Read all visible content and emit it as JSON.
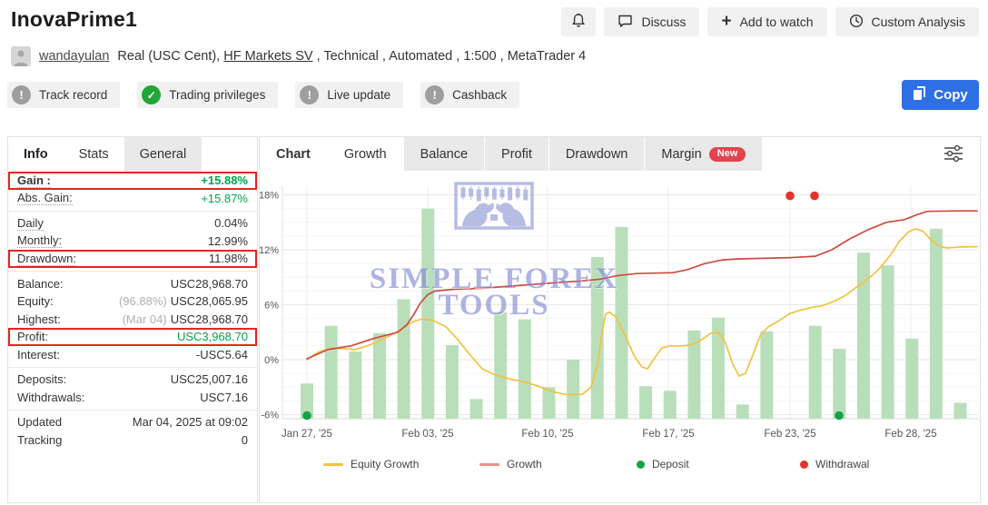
{
  "header": {
    "title": "InovaPrime1",
    "actions": [
      {
        "label": "Discuss",
        "icon": "chat-bubble-icon"
      },
      {
        "label": "Add to watch",
        "icon": "plus-icon"
      },
      {
        "label": "Custom Analysis",
        "icon": "clock-icon"
      }
    ],
    "account": {
      "user": "wandayulan",
      "meta_1": "Real (USC Cent), ",
      "broker": "HF Markets SV",
      "meta_2": " , Technical , Automated , 1:500 , MetaTrader 4"
    },
    "badges": [
      {
        "label": "Track record",
        "status": "warn"
      },
      {
        "label": "Trading privileges",
        "status": "ok"
      },
      {
        "label": "Live update",
        "status": "warn"
      },
      {
        "label": "Cashback",
        "status": "warn"
      }
    ],
    "copy_label": "Copy"
  },
  "colors": {
    "accent_blue": "#2f6fe4",
    "positive_green": "#00a651",
    "highlight_red_box": "#e22621",
    "verified_green": "#21a637",
    "badge_gray": "#9e9e9e",
    "new_badge": "#e0444e",
    "bar_green": "#b9dfba",
    "equity_line_yellow": "#f2c240",
    "growth_line_red": "#cf4a41",
    "deposit_dot_green": "#17a147",
    "withdrawal_dot_red": "#e63228",
    "watermark_blue": "#9aa2dd"
  },
  "sidebar": {
    "tabs": [
      {
        "label": "Info",
        "style": "bold"
      },
      {
        "label": "Stats",
        "style": ""
      },
      {
        "label": "General",
        "style": "filled"
      }
    ],
    "rows": [
      {
        "label": "Gain :",
        "value": "+15.88%",
        "green": true,
        "boxed": true,
        "dotted": true,
        "bold": true
      },
      {
        "label": "Abs. Gain:",
        "value": "+15.87%",
        "green": true,
        "dotted": true
      },
      {
        "divider": true
      },
      {
        "label": "Daily",
        "value": "0.04%",
        "dotted": true
      },
      {
        "label": "Monthly:",
        "value": "12.99%",
        "dotted": true
      },
      {
        "label": "Drawdown:",
        "value": "11.98%",
        "boxed": true,
        "dotted": true
      },
      {
        "divider": true
      },
      {
        "label": "Balance:",
        "value": "USC28,968.70"
      },
      {
        "label": "Equity:",
        "prefix": "(96.88%)",
        "value": "USC28,065.95"
      },
      {
        "label": "Highest:",
        "prefix": "(Mar 04)",
        "value": "USC28,968.70"
      },
      {
        "label": "Profit:",
        "value": "USC3,968.70",
        "green": true,
        "boxed": true
      },
      {
        "label": "Interest:",
        "value": "-USC5.64"
      },
      {
        "divider": true
      },
      {
        "label": "Deposits:",
        "value": "USC25,007.16"
      },
      {
        "label": "Withdrawals:",
        "value": "USC7.16"
      },
      {
        "divider": true
      },
      {
        "label": "Updated",
        "value": "Mar 04, 2025 at 09:02"
      },
      {
        "label": "Tracking",
        "value": "0"
      }
    ]
  },
  "chart_tabs": [
    {
      "label": "Chart",
      "bold": true,
      "white": true
    },
    {
      "label": "Growth",
      "white": true
    },
    {
      "label": "Balance"
    },
    {
      "label": "Profit"
    },
    {
      "label": "Drawdown"
    },
    {
      "label": "Margin",
      "badge": "New"
    }
  ],
  "chart_data": {
    "type": "bar+line",
    "title": "Growth",
    "grid": true,
    "y_axis": {
      "tick_values": [
        18,
        12,
        6,
        0,
        -6
      ],
      "tick_suffix": "%",
      "min": -6.5,
      "max": 18.8
    },
    "x_axis": {
      "labels": [
        "Jan 27, '25",
        "Feb 03, '25",
        "Feb 10, '25",
        "Feb 17, '25",
        "Feb 23, '25",
        "Feb 28, '25"
      ],
      "positions": [
        52,
        185,
        317,
        450,
        584,
        717
      ]
    },
    "bars": {
      "name": "Daily change",
      "color": "#b9dfba",
      "x_start": 52,
      "step": 26.65,
      "width": 14,
      "baseline": -6.45,
      "values": [
        -2.6,
        3.7,
        0.9,
        2.9,
        6.6,
        16.5,
        1.6,
        -4.3,
        5.2,
        4.4,
        -3.0,
        0.0,
        11.2,
        14.5,
        -2.9,
        -3.4,
        3.2,
        4.6,
        -4.9,
        3.1,
        null,
        3.7,
        1.2,
        11.7,
        10.3,
        2.3,
        14.3,
        -4.7
      ]
    },
    "series": [
      {
        "name": "Equity Growth",
        "color": "#f2c240",
        "points": [
          [
            52,
            0
          ],
          [
            65,
            0.85
          ],
          [
            78,
            1.25
          ],
          [
            93,
            1.2
          ],
          [
            105,
            1.1
          ],
          [
            118,
            1.5
          ],
          [
            131,
            2.0
          ],
          [
            145,
            2.7
          ],
          [
            157,
            3.4
          ],
          [
            170,
            4.2
          ],
          [
            180,
            4.45
          ],
          [
            191,
            4.3
          ],
          [
            205,
            3.6
          ],
          [
            218,
            2.2
          ],
          [
            231,
            0.6
          ],
          [
            245,
            -1.0
          ],
          [
            260,
            -1.7
          ],
          [
            275,
            -2.1
          ],
          [
            290,
            -2.4
          ],
          [
            307,
            -2.9
          ],
          [
            323,
            -3.5
          ],
          [
            337,
            -3.8
          ],
          [
            355,
            -3.8
          ],
          [
            365,
            -3.0
          ],
          [
            372,
            -0.5
          ],
          [
            377,
            3.0
          ],
          [
            381,
            5.0
          ],
          [
            385,
            5.2
          ],
          [
            393,
            4.6
          ],
          [
            403,
            2.5
          ],
          [
            413,
            0.3
          ],
          [
            421,
            -0.8
          ],
          [
            427,
            -1.0
          ],
          [
            435,
            0.2
          ],
          [
            443,
            1.3
          ],
          [
            451,
            1.5
          ],
          [
            463,
            1.5
          ],
          [
            475,
            1.6
          ],
          [
            487,
            2.2
          ],
          [
            497,
            2.9
          ],
          [
            505,
            3.0
          ],
          [
            513,
            1.8
          ],
          [
            521,
            -0.5
          ],
          [
            528,
            -1.8
          ],
          [
            535,
            -1.5
          ],
          [
            543,
            0.5
          ],
          [
            551,
            2.6
          ],
          [
            560,
            3.6
          ],
          [
            571,
            4.2
          ],
          [
            583,
            5.0
          ],
          [
            595,
            5.4
          ],
          [
            608,
            5.7
          ],
          [
            620,
            5.9
          ],
          [
            633,
            6.4
          ],
          [
            645,
            7.0
          ],
          [
            658,
            8.0
          ],
          [
            670,
            8.8
          ],
          [
            683,
            10.0
          ],
          [
            695,
            11.5
          ],
          [
            705,
            13.0
          ],
          [
            715,
            14.0
          ],
          [
            723,
            14.3
          ],
          [
            731,
            14.0
          ],
          [
            740,
            13.0
          ],
          [
            748,
            12.4
          ],
          [
            757,
            12.2
          ],
          [
            770,
            12.3
          ],
          [
            790,
            12.35
          ]
        ]
      },
      {
        "name": "Growth",
        "color": "#cf4a41",
        "legend_color": "#e4918a",
        "points": [
          [
            52,
            0.1
          ],
          [
            75,
            1.1
          ],
          [
            100,
            1.5
          ],
          [
            125,
            2.3
          ],
          [
            152,
            3.0
          ],
          [
            162,
            3.8
          ],
          [
            170,
            5.0
          ],
          [
            177,
            6.2
          ],
          [
            185,
            7.1
          ],
          [
            193,
            7.5
          ],
          [
            215,
            7.7
          ],
          [
            245,
            7.8
          ],
          [
            285,
            8.1
          ],
          [
            325,
            8.4
          ],
          [
            355,
            8.6
          ],
          [
            375,
            8.8
          ],
          [
            395,
            9.2
          ],
          [
            415,
            9.4
          ],
          [
            435,
            9.45
          ],
          [
            455,
            9.5
          ],
          [
            470,
            9.8
          ],
          [
            490,
            10.5
          ],
          [
            510,
            10.9
          ],
          [
            525,
            11.0
          ],
          [
            545,
            11.05
          ],
          [
            565,
            11.1
          ],
          [
            585,
            11.15
          ],
          [
            612,
            11.3
          ],
          [
            630,
            12.0
          ],
          [
            650,
            13.2
          ],
          [
            670,
            14.2
          ],
          [
            690,
            15.0
          ],
          [
            710,
            15.3
          ],
          [
            723,
            15.8
          ],
          [
            735,
            16.2
          ],
          [
            770,
            16.25
          ],
          [
            790,
            16.25
          ]
        ]
      }
    ],
    "markers": [
      {
        "name": "Deposit",
        "color": "#17a147",
        "points": [
          [
            52,
            -6.1
          ],
          [
            638,
            -6.1
          ]
        ]
      },
      {
        "name": "Withdrawal",
        "color": "#e63228",
        "points": [
          [
            584,
            17.9
          ],
          [
            611,
            17.9
          ]
        ]
      }
    ],
    "legend": [
      {
        "label": "Equity Growth",
        "swatch": "line",
        "color": "#f2c240"
      },
      {
        "label": "Growth",
        "swatch": "line",
        "color": "#e4918a"
      },
      {
        "label": "Deposit",
        "swatch": "dot",
        "color": "#17a147"
      },
      {
        "label": "Withdrawal",
        "swatch": "dot",
        "color": "#e63228"
      }
    ],
    "watermark": {
      "line1": "SIMPLE FOREX",
      "line2": "TOOLS"
    }
  }
}
